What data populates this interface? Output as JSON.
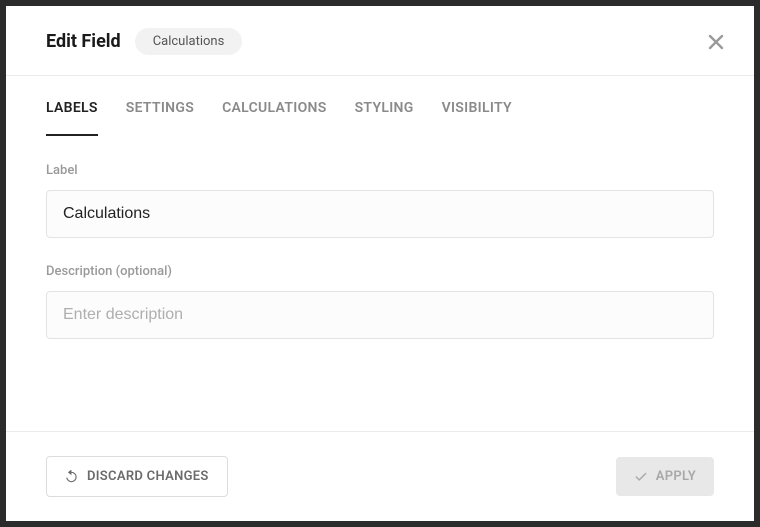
{
  "header": {
    "title": "Edit Field",
    "tag": "Calculations"
  },
  "tabs": {
    "t0": "LABELS",
    "t1": "SETTINGS",
    "t2": "CALCULATIONS",
    "t3": "STYLING",
    "t4": "VISIBILITY"
  },
  "form": {
    "label_caption": "Label",
    "label_value": "Calculations",
    "description_caption": "Description (optional)",
    "description_value": "",
    "description_placeholder": "Enter description"
  },
  "footer": {
    "discard": "DISCARD CHANGES",
    "apply": "APPLY"
  }
}
